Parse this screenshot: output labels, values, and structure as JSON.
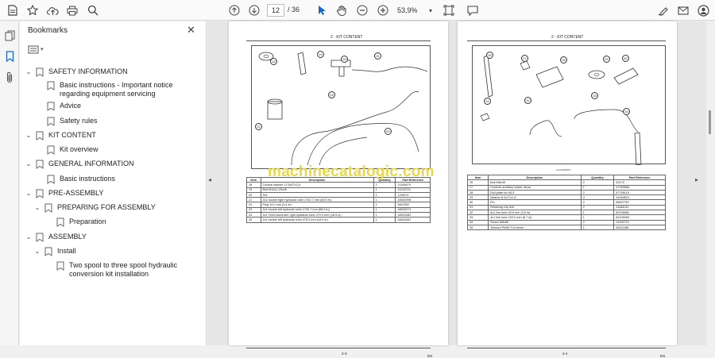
{
  "toolbar": {
    "current_page": "12",
    "page_total": "/ 36",
    "zoom": "53,9%"
  },
  "bookmarks_panel": {
    "title": "Bookmarks",
    "items": [
      {
        "label": "SAFETY INFORMATION",
        "level": 0,
        "expanded": true
      },
      {
        "label": "Basic instructions - Important notice regarding equipment servicing",
        "level": 1
      },
      {
        "label": "Advice",
        "level": 1
      },
      {
        "label": "Safety rules",
        "level": 1
      },
      {
        "label": "KIT CONTENT",
        "level": 0,
        "expanded": true
      },
      {
        "label": "Kit overview",
        "level": 1
      },
      {
        "label": "GENERAL INFORMATION",
        "level": 0,
        "expanded": true
      },
      {
        "label": "Basic instructions",
        "level": 1
      },
      {
        "label": "PRE-ASSEMBLY",
        "level": 0,
        "expanded": true
      },
      {
        "label": "PREPARING FOR ASSEMBLY",
        "level": 1,
        "expanded": true
      },
      {
        "label": "Preparation",
        "level": 2
      },
      {
        "label": "ASSEMBLY",
        "level": 0,
        "expanded": true
      },
      {
        "label": "Install",
        "level": 1,
        "expanded": true
      },
      {
        "label": "Two spool to three spool hydraulic conversion kit installation",
        "level": 2
      }
    ]
  },
  "left_page": {
    "header": "2 - KIT CONTENT",
    "table_headers": [
      "Item",
      "Description",
      "Quantity",
      "Part Reference"
    ],
    "rows": [
      [
        "18",
        "Conical washer 12,5x27x2,6",
        "1",
        "11195679"
      ],
      [
        "19",
        "Bolt M10x1,25x45",
        "1",
        "11234721"
      ],
      [
        "20",
        "Tee",
        "1",
        "1/39074"
      ],
      [
        "21",
        "4x1 bucket right hydraulic tube 1740.7 mm (68.5 in)",
        "1",
        "48002098"
      ],
      [
        "22",
        "Plug 10.0 mm (0.4 in)",
        "1",
        "5847592"
      ],
      [
        "23",
        "4x1 bucket left hydraulic tube 1740.7 mm (68.5 in)",
        "1",
        "48002074"
      ],
      [
        "24",
        "4x1 Feed band arm right hydraulic tube 470.0 mm (18.5 in)",
        "1",
        "48002082"
      ],
      [
        "25",
        "4x1 bucket left hydraulic tube 470.0 mm (18.5 in)",
        "1",
        "48002087"
      ]
    ],
    "footer_page": "2-3",
    "footer_lang": "EN",
    "callouts": [
      "18",
      "19",
      "20",
      "21",
      "22",
      "23",
      "24",
      "25"
    ]
  },
  "right_page": {
    "header": "2 - KIT CONTENT",
    "figure_caption": "CLICKPARTS",
    "table_headers": [
      "Item",
      "Description",
      "Quantity",
      "Part Reference"
    ],
    "rows": [
      [
        "26",
        "Bolt M8x40",
        "2",
        "40170"
      ],
      [
        "27",
        "Controls auxiliary loader decal",
        "1",
        "47469568"
      ],
      [
        "28",
        "Roll-plate for M13",
        "2",
        "87755119"
      ],
      [
        "29",
        "Washer 8.4x17x1.6",
        "4",
        "14464521"
      ],
      [
        "30",
        "Pin",
        "2",
        "85607787"
      ],
      [
        "31",
        "Retaining clip 8x6",
        "2",
        "11064011"
      ],
      [
        "32",
        "4x1 line tube 90.6 mm (3.6 in)",
        "1",
        "82105082"
      ],
      [
        "33",
        "4x1 line tube 220.0 mm (8.7 in)",
        "1",
        "82105065"
      ],
      [
        "34",
        "Screw M8x80",
        "2",
        "14302721"
      ],
      [
        "35",
        "Teknord PWM TLB driver",
        "1",
        "48111188"
      ]
    ],
    "footer_page": "2-4",
    "footer_lang": "EN",
    "callouts": [
      "26",
      "27",
      "28",
      "29",
      "30",
      "31",
      "32",
      "33",
      "34",
      "35"
    ]
  },
  "watermark": "machinecatalogic.com"
}
